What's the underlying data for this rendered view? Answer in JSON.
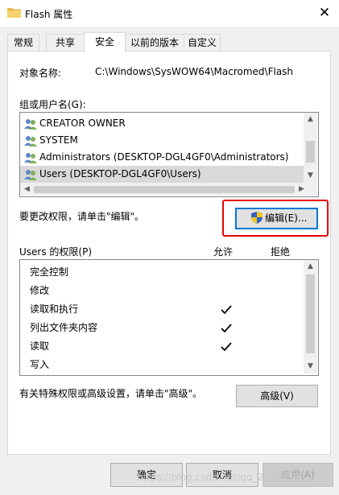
{
  "window": {
    "title": "Flash 属性",
    "close_glyph": "✕"
  },
  "tabs": [
    {
      "label": "常规"
    },
    {
      "label": "共享"
    },
    {
      "label": "安全"
    },
    {
      "label": "以前的版本"
    },
    {
      "label": "自定义"
    }
  ],
  "object": {
    "label": "对象名称:",
    "value": "C:\\Windows\\SysWOW64\\Macromed\\Flash"
  },
  "groups": {
    "label": "组或用户名(G):",
    "items": [
      {
        "label": "CREATOR OWNER",
        "selected": false
      },
      {
        "label": "SYSTEM",
        "selected": false
      },
      {
        "label": "Administrators (DESKTOP-DGL4GF0\\Administrators)",
        "selected": false
      },
      {
        "label": "Users (DESKTOP-DGL4GF0\\Users)",
        "selected": true
      }
    ]
  },
  "edit": {
    "hint": "要更改权限，请单击\"编辑\"。",
    "button_label": "编辑(E)..."
  },
  "permissions": {
    "label": "Users 的权限(P)",
    "allow_header": "允许",
    "deny_header": "拒绝",
    "rows": [
      {
        "label": "完全控制",
        "allow": false,
        "deny": false
      },
      {
        "label": "修改",
        "allow": false,
        "deny": false
      },
      {
        "label": "读取和执行",
        "allow": true,
        "deny": false
      },
      {
        "label": "列出文件夹内容",
        "allow": true,
        "deny": false
      },
      {
        "label": "读取",
        "allow": true,
        "deny": false
      },
      {
        "label": "写入",
        "allow": false,
        "deny": false
      }
    ]
  },
  "advanced": {
    "hint": "有关特殊权限或高级设置，请单击\"高级\"。",
    "button_label": "高级(V)"
  },
  "footer": {
    "ok": "确定",
    "cancel": "取消",
    "apply": "应用(A)"
  },
  "watermark": "https://blog.csdn.net/qq_26884501",
  "colors": {
    "selection": "#d9d9d9",
    "highlight": "#e60000",
    "default_border": "#0078d7"
  }
}
